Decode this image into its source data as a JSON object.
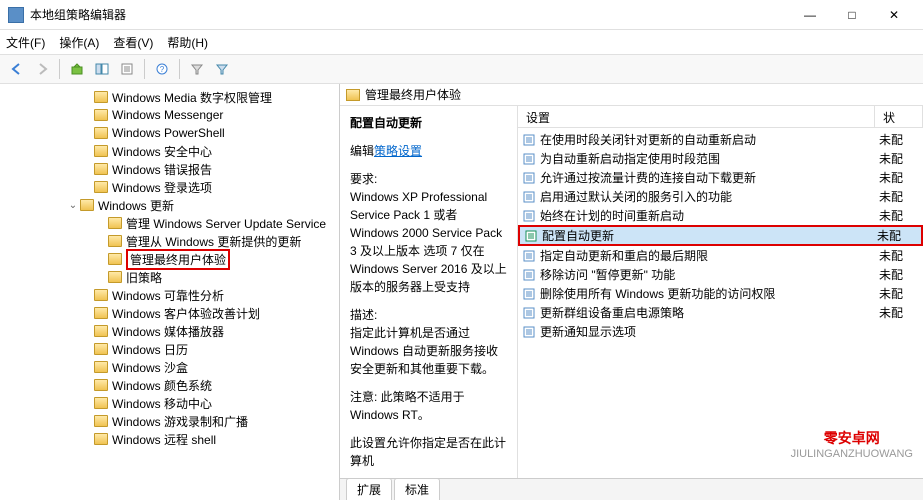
{
  "window": {
    "title": "本地组策略编辑器",
    "minimize": "—",
    "maximize": "□",
    "close": "✕"
  },
  "menus": {
    "file": "文件(F)",
    "action": "操作(A)",
    "view": "查看(V)",
    "help": "帮助(H)"
  },
  "tree": {
    "items": [
      {
        "indent": 80,
        "label": "Windows Media 数字权限管理",
        "expanded": null
      },
      {
        "indent": 80,
        "label": "Windows Messenger",
        "expanded": null
      },
      {
        "indent": 80,
        "label": "Windows PowerShell",
        "expanded": null
      },
      {
        "indent": 80,
        "label": "Windows 安全中心",
        "expanded": null
      },
      {
        "indent": 80,
        "label": "Windows 错误报告",
        "expanded": null
      },
      {
        "indent": 80,
        "label": "Windows 登录选项",
        "expanded": null
      },
      {
        "indent": 66,
        "label": "Windows 更新",
        "expanded": true
      },
      {
        "indent": 94,
        "label": "管理 Windows Server Update Service",
        "expanded": null
      },
      {
        "indent": 94,
        "label": "管理从 Windows 更新提供的更新",
        "expanded": null
      },
      {
        "indent": 94,
        "label": "管理最终用户体验",
        "expanded": null,
        "highlighted": true
      },
      {
        "indent": 94,
        "label": "旧策略",
        "expanded": null
      },
      {
        "indent": 80,
        "label": "Windows 可靠性分析",
        "expanded": null
      },
      {
        "indent": 80,
        "label": "Windows 客户体验改善计划",
        "expanded": null
      },
      {
        "indent": 80,
        "label": "Windows 媒体播放器",
        "expanded": null
      },
      {
        "indent": 80,
        "label": "Windows 日历",
        "expanded": null
      },
      {
        "indent": 80,
        "label": "Windows 沙盒",
        "expanded": null
      },
      {
        "indent": 80,
        "label": "Windows 颜色系统",
        "expanded": null
      },
      {
        "indent": 80,
        "label": "Windows 移动中心",
        "expanded": null
      },
      {
        "indent": 80,
        "label": "Windows 游戏录制和广播",
        "expanded": null
      },
      {
        "indent": 80,
        "label": "Windows 远程 shell",
        "expanded": null
      }
    ]
  },
  "right": {
    "header": "管理最终用户体验",
    "detail": {
      "title": "配置自动更新",
      "edit_prefix": "编辑",
      "edit_link": "策略设置",
      "requirements_label": "要求:",
      "requirements_text": "Windows XP Professional Service Pack 1 或者 Windows 2000 Service Pack 3 及以上版本 选项 7 仅在 Windows Server 2016 及以上版本的服务器上受支持",
      "description_label": "描述:",
      "description_text": "指定此计算机是否通过 Windows 自动更新服务接收安全更新和其他重要下载。",
      "note_text": "注意: 此策略不适用于 Windows RT。",
      "extra_text": "此设置允许你指定是否在此计算机"
    },
    "columns": {
      "setting": "设置",
      "status": "状"
    },
    "items": [
      {
        "label": "在使用时段关闭针对更新的自动重新启动",
        "status": "未配"
      },
      {
        "label": "为自动重新启动指定使用时段范围",
        "status": "未配"
      },
      {
        "label": "允许通过按流量计费的连接自动下载更新",
        "status": "未配"
      },
      {
        "label": "启用通过默认关闭的服务引入的功能",
        "status": "未配"
      },
      {
        "label": "始终在计划的时间重新启动",
        "status": "未配"
      },
      {
        "label": "配置自动更新",
        "status": "未配",
        "selected": true,
        "highlighted": true
      },
      {
        "label": "指定自动更新和重启的最后期限",
        "status": "未配"
      },
      {
        "label": "移除访问 \"暂停更新\" 功能",
        "status": "未配"
      },
      {
        "label": "删除使用所有 Windows 更新功能的访问权限",
        "status": "未配"
      },
      {
        "label": "更新群组设备重启电源策略",
        "status": "未配"
      },
      {
        "label": "更新通知显示选项",
        "status": ""
      }
    ],
    "tabs": {
      "extended": "扩展",
      "standard": "标准"
    }
  },
  "watermark": {
    "brand": "零安卓网",
    "domain": "JIULINGANZHUOWANG"
  }
}
